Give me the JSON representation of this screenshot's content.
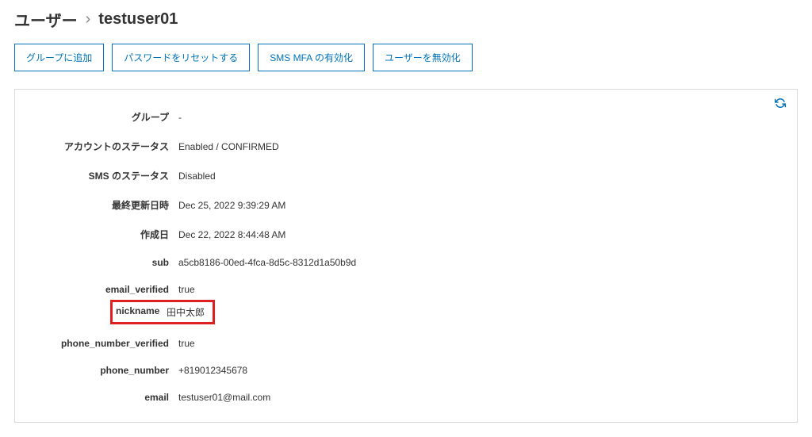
{
  "breadcrumb": {
    "root": "ユーザー",
    "sep": "›",
    "current": "testuser01"
  },
  "actions": {
    "addToGroup": "グループに追加",
    "resetPassword": "パスワードをリセットする",
    "enableSmsMfa": "SMS MFA の有効化",
    "disableUser": "ユーザーを無効化"
  },
  "details": {
    "group": {
      "label": "グループ",
      "value": "-"
    },
    "accountStatus": {
      "label": "アカウントのステータス",
      "value": "Enabled / CONFIRMED"
    },
    "smsStatus": {
      "label": "SMS のステータス",
      "value": "Disabled"
    },
    "lastModified": {
      "label": "最終更新日時",
      "value": "Dec 25, 2022 9:39:29 AM"
    },
    "created": {
      "label": "作成日",
      "value": "Dec 22, 2022 8:44:48 AM"
    },
    "sub": {
      "label": "sub",
      "value": "a5cb8186-00ed-4fca-8d5c-8312d1a50b9d"
    },
    "emailVerified": {
      "label": "email_verified",
      "value": "true"
    },
    "nickname": {
      "label": "nickname",
      "value": "田中太郎"
    },
    "phoneNumberVerified": {
      "label": "phone_number_verified",
      "value": "true"
    },
    "phoneNumber": {
      "label": "phone_number",
      "value": "+819012345678"
    },
    "email": {
      "label": "email",
      "value": "testuser01@mail.com"
    }
  }
}
